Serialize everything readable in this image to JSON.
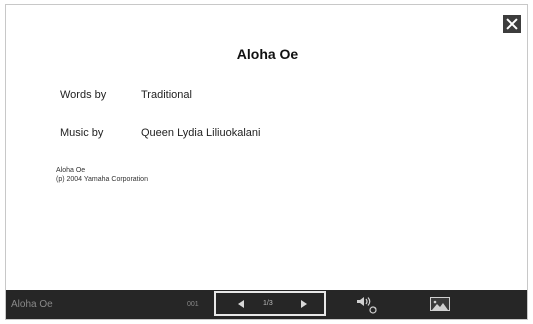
{
  "score": {
    "title": "Aloha Oe",
    "words_label": "Words by",
    "words_value": "Traditional",
    "music_label": "Music by",
    "music_value": "Queen Lydia Liliuokalani",
    "copyright_line1": "Aloha Oe",
    "copyright_line2": "(p) 2004 Yamaha Corporation"
  },
  "bottom_bar": {
    "song_name": "Aloha Oe",
    "song_number": "001",
    "page_indicator": "1/3"
  },
  "icons": {
    "close": "close-icon",
    "prev": "triangle-left-icon",
    "next": "triangle-right-icon",
    "volume": "speaker-repeat-icon",
    "image": "picture-icon"
  }
}
